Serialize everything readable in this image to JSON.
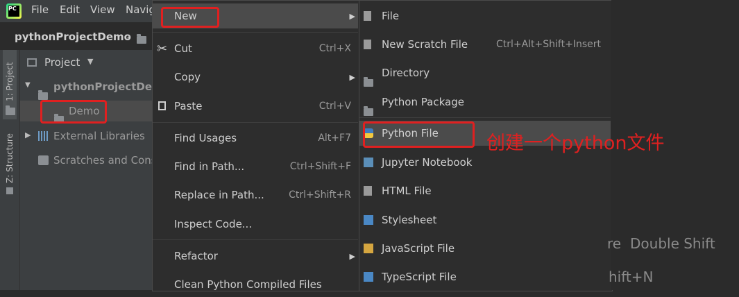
{
  "app_logo": "PC",
  "menubar": {
    "items": [
      "File",
      "Edit",
      "View",
      "Navig"
    ]
  },
  "breadcrumb": {
    "project": "pythonProjectDemo"
  },
  "toolstrip": {
    "project_tab": "1: Project",
    "structure_tab": "Z: Structure"
  },
  "project_panel": {
    "header": "Project",
    "root": "pythonProjectDem",
    "demo": "Demo",
    "external": "External Libraries",
    "scratches": "Scratches and Cons"
  },
  "context_menu": {
    "new": "New",
    "cut": {
      "label": "Cut",
      "shortcut": "Ctrl+X"
    },
    "copy": "Copy",
    "paste": {
      "label": "Paste",
      "shortcut": "Ctrl+V"
    },
    "find_usages": {
      "label": "Find Usages",
      "shortcut": "Alt+F7"
    },
    "find_in_path": {
      "label": "Find in Path...",
      "shortcut": "Ctrl+Shift+F"
    },
    "replace_in_path": {
      "label": "Replace in Path...",
      "shortcut": "Ctrl+Shift+R"
    },
    "inspect_code": "Inspect Code...",
    "refactor": "Refactor",
    "clean": "Clean Python Compiled Files"
  },
  "submenu": {
    "file": "File",
    "scratch": {
      "label": "New Scratch File",
      "shortcut": "Ctrl+Alt+Shift+Insert"
    },
    "directory": "Directory",
    "package": "Python Package",
    "python_file": "Python File",
    "jupyter": "Jupyter Notebook",
    "html": "HTML File",
    "stylesheet": "Stylesheet",
    "javascript": "JavaScript File",
    "typescript": "TypeScript File"
  },
  "editor_hints": {
    "hint1_tail": "re",
    "hint1_key": "Double Shift",
    "hint2_tail": "hift+N"
  },
  "annotation": "创建一个python文件",
  "colors": {
    "highlight_box": "#e02020",
    "menu_bg": "#2d2d2d",
    "panel_bg": "#3c3f41"
  }
}
